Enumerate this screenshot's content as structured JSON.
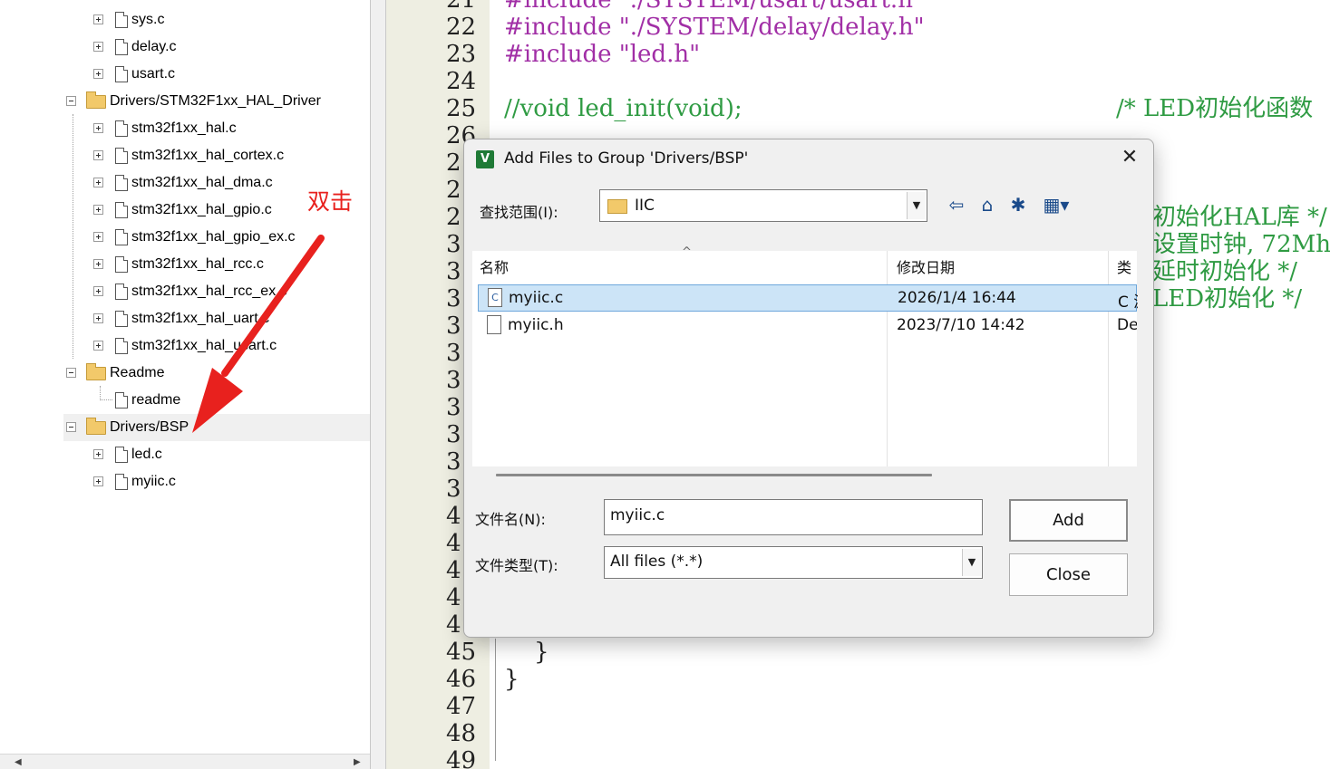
{
  "tree": {
    "items": [
      {
        "label": "sys.c",
        "kind": "file",
        "expander": "plus"
      },
      {
        "label": "delay.c",
        "kind": "file",
        "expander": "plus"
      },
      {
        "label": "usart.c",
        "kind": "file",
        "expander": "plus"
      },
      {
        "label": "Drivers/STM32F1xx_HAL_Driver",
        "kind": "group",
        "expander": "minus"
      },
      {
        "label": "stm32f1xx_hal.c",
        "kind": "file",
        "expander": "plus"
      },
      {
        "label": "stm32f1xx_hal_cortex.c",
        "kind": "file",
        "expander": "plus"
      },
      {
        "label": "stm32f1xx_hal_dma.c",
        "kind": "file",
        "expander": "plus"
      },
      {
        "label": "stm32f1xx_hal_gpio.c",
        "kind": "file",
        "expander": "plus"
      },
      {
        "label": "stm32f1xx_hal_gpio_ex.c",
        "kind": "file",
        "expander": "plus"
      },
      {
        "label": "stm32f1xx_hal_rcc.c",
        "kind": "file",
        "expander": "plus"
      },
      {
        "label": "stm32f1xx_hal_rcc_ex.c",
        "kind": "file",
        "expander": "plus"
      },
      {
        "label": "stm32f1xx_hal_uart.c",
        "kind": "file",
        "expander": "plus"
      },
      {
        "label": "stm32f1xx_hal_usart.c",
        "kind": "file",
        "expander": "plus"
      },
      {
        "label": "Readme",
        "kind": "group",
        "expander": "minus"
      },
      {
        "label": "readme",
        "kind": "file",
        "expander": "none"
      },
      {
        "label": "Drivers/BSP",
        "kind": "group",
        "expander": "minus",
        "selected": true
      },
      {
        "label": "led.c",
        "kind": "file",
        "expander": "plus"
      },
      {
        "label": "myiic.c",
        "kind": "file",
        "expander": "plus"
      }
    ]
  },
  "annotation": {
    "text": "双击",
    "color": "#e8211e"
  },
  "editor": {
    "line_numbers": [
      "21",
      "22",
      "23",
      "24",
      "25",
      "26",
      "2",
      "2",
      "2",
      "3",
      "3",
      "3",
      "3",
      "3",
      "3",
      "3",
      "3",
      "3",
      "3",
      "4",
      "4",
      "4",
      "4",
      "4",
      "45",
      "46",
      "47",
      "48",
      "49"
    ],
    "code_lines": [
      {
        "text": "#include \"./SYSTEM/usart/usart.h\"",
        "kind": "pp"
      },
      {
        "text": "#include \"./SYSTEM/delay/delay.h\"",
        "kind": "pp"
      },
      {
        "text": "#include \"led.h\"",
        "kind": "pp"
      },
      {
        "text": "",
        "kind": "plain"
      },
      {
        "text": "//void led_init(void);",
        "kind": "cm"
      }
    ],
    "right_comments": [
      "/* LED初始化函数",
      "初始化HAL库 */",
      "设置时钟, 72Mh",
      "延时初始化 */",
      "LED初始化 */"
    ],
    "closing_lines": [
      "    }",
      "}"
    ],
    "colors": {
      "preprocessor": "#a12fa6",
      "comment": "#2f9b43",
      "gutter": "#eeeee2"
    }
  },
  "dialog": {
    "title": "Add Files to Group 'Drivers/BSP'",
    "app_icon": "V",
    "close_glyph": "✕",
    "look_in_label": "查找范围(I):",
    "look_in_value": "IIC",
    "toolbar_icons": [
      "back-icon",
      "up-folder-icon",
      "new-folder-icon",
      "view-menu-icon"
    ],
    "columns": [
      "名称",
      "修改日期",
      "类"
    ],
    "files": [
      {
        "name": "myiic.c",
        "date": "2026/1/4 16:44",
        "type": "C 源",
        "icon": "c-file-icon",
        "selected": true
      },
      {
        "name": "myiic.h",
        "date": "2023/7/10 14:42",
        "type": "De",
        "icon": "h-file-icon",
        "selected": false
      }
    ],
    "filename_label": "文件名(N):",
    "filename_value": "myiic.c",
    "filetype_label": "文件类型(T):",
    "filetype_value": "All files (*.*)",
    "add_label": "Add",
    "close_label": "Close"
  }
}
